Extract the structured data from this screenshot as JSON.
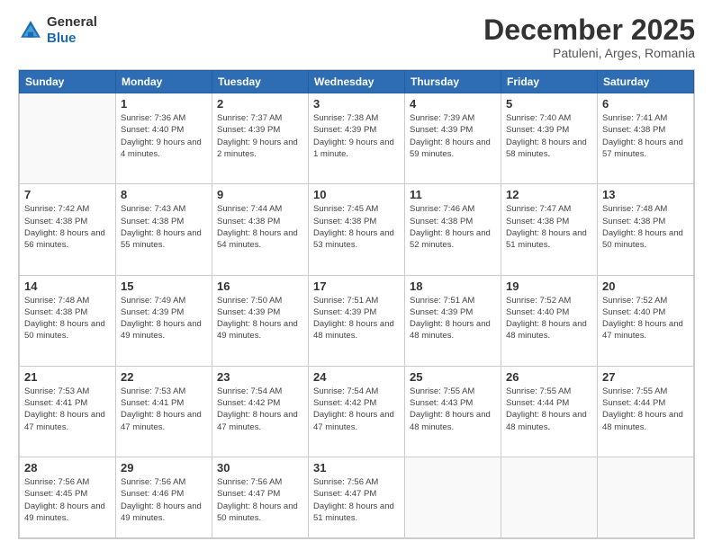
{
  "logo": {
    "general": "General",
    "blue": "Blue"
  },
  "header": {
    "month": "December 2025",
    "location": "Patuleni, Arges, Romania"
  },
  "weekdays": [
    "Sunday",
    "Monday",
    "Tuesday",
    "Wednesday",
    "Thursday",
    "Friday",
    "Saturday"
  ],
  "weeks": [
    [
      {
        "day": "",
        "sunrise": "",
        "sunset": "",
        "daylight": ""
      },
      {
        "day": "1",
        "sunrise": "Sunrise: 7:36 AM",
        "sunset": "Sunset: 4:40 PM",
        "daylight": "Daylight: 9 hours and 4 minutes."
      },
      {
        "day": "2",
        "sunrise": "Sunrise: 7:37 AM",
        "sunset": "Sunset: 4:39 PM",
        "daylight": "Daylight: 9 hours and 2 minutes."
      },
      {
        "day": "3",
        "sunrise": "Sunrise: 7:38 AM",
        "sunset": "Sunset: 4:39 PM",
        "daylight": "Daylight: 9 hours and 1 minute."
      },
      {
        "day": "4",
        "sunrise": "Sunrise: 7:39 AM",
        "sunset": "Sunset: 4:39 PM",
        "daylight": "Daylight: 8 hours and 59 minutes."
      },
      {
        "day": "5",
        "sunrise": "Sunrise: 7:40 AM",
        "sunset": "Sunset: 4:39 PM",
        "daylight": "Daylight: 8 hours and 58 minutes."
      },
      {
        "day": "6",
        "sunrise": "Sunrise: 7:41 AM",
        "sunset": "Sunset: 4:38 PM",
        "daylight": "Daylight: 8 hours and 57 minutes."
      }
    ],
    [
      {
        "day": "7",
        "sunrise": "Sunrise: 7:42 AM",
        "sunset": "Sunset: 4:38 PM",
        "daylight": "Daylight: 8 hours and 56 minutes."
      },
      {
        "day": "8",
        "sunrise": "Sunrise: 7:43 AM",
        "sunset": "Sunset: 4:38 PM",
        "daylight": "Daylight: 8 hours and 55 minutes."
      },
      {
        "day": "9",
        "sunrise": "Sunrise: 7:44 AM",
        "sunset": "Sunset: 4:38 PM",
        "daylight": "Daylight: 8 hours and 54 minutes."
      },
      {
        "day": "10",
        "sunrise": "Sunrise: 7:45 AM",
        "sunset": "Sunset: 4:38 PM",
        "daylight": "Daylight: 8 hours and 53 minutes."
      },
      {
        "day": "11",
        "sunrise": "Sunrise: 7:46 AM",
        "sunset": "Sunset: 4:38 PM",
        "daylight": "Daylight: 8 hours and 52 minutes."
      },
      {
        "day": "12",
        "sunrise": "Sunrise: 7:47 AM",
        "sunset": "Sunset: 4:38 PM",
        "daylight": "Daylight: 8 hours and 51 minutes."
      },
      {
        "day": "13",
        "sunrise": "Sunrise: 7:48 AM",
        "sunset": "Sunset: 4:38 PM",
        "daylight": "Daylight: 8 hours and 50 minutes."
      }
    ],
    [
      {
        "day": "14",
        "sunrise": "Sunrise: 7:48 AM",
        "sunset": "Sunset: 4:38 PM",
        "daylight": "Daylight: 8 hours and 50 minutes."
      },
      {
        "day": "15",
        "sunrise": "Sunrise: 7:49 AM",
        "sunset": "Sunset: 4:39 PM",
        "daylight": "Daylight: 8 hours and 49 minutes."
      },
      {
        "day": "16",
        "sunrise": "Sunrise: 7:50 AM",
        "sunset": "Sunset: 4:39 PM",
        "daylight": "Daylight: 8 hours and 49 minutes."
      },
      {
        "day": "17",
        "sunrise": "Sunrise: 7:51 AM",
        "sunset": "Sunset: 4:39 PM",
        "daylight": "Daylight: 8 hours and 48 minutes."
      },
      {
        "day": "18",
        "sunrise": "Sunrise: 7:51 AM",
        "sunset": "Sunset: 4:39 PM",
        "daylight": "Daylight: 8 hours and 48 minutes."
      },
      {
        "day": "19",
        "sunrise": "Sunrise: 7:52 AM",
        "sunset": "Sunset: 4:40 PM",
        "daylight": "Daylight: 8 hours and 48 minutes."
      },
      {
        "day": "20",
        "sunrise": "Sunrise: 7:52 AM",
        "sunset": "Sunset: 4:40 PM",
        "daylight": "Daylight: 8 hours and 47 minutes."
      }
    ],
    [
      {
        "day": "21",
        "sunrise": "Sunrise: 7:53 AM",
        "sunset": "Sunset: 4:41 PM",
        "daylight": "Daylight: 8 hours and 47 minutes."
      },
      {
        "day": "22",
        "sunrise": "Sunrise: 7:53 AM",
        "sunset": "Sunset: 4:41 PM",
        "daylight": "Daylight: 8 hours and 47 minutes."
      },
      {
        "day": "23",
        "sunrise": "Sunrise: 7:54 AM",
        "sunset": "Sunset: 4:42 PM",
        "daylight": "Daylight: 8 hours and 47 minutes."
      },
      {
        "day": "24",
        "sunrise": "Sunrise: 7:54 AM",
        "sunset": "Sunset: 4:42 PM",
        "daylight": "Daylight: 8 hours and 47 minutes."
      },
      {
        "day": "25",
        "sunrise": "Sunrise: 7:55 AM",
        "sunset": "Sunset: 4:43 PM",
        "daylight": "Daylight: 8 hours and 48 minutes."
      },
      {
        "day": "26",
        "sunrise": "Sunrise: 7:55 AM",
        "sunset": "Sunset: 4:44 PM",
        "daylight": "Daylight: 8 hours and 48 minutes."
      },
      {
        "day": "27",
        "sunrise": "Sunrise: 7:55 AM",
        "sunset": "Sunset: 4:44 PM",
        "daylight": "Daylight: 8 hours and 48 minutes."
      }
    ],
    [
      {
        "day": "28",
        "sunrise": "Sunrise: 7:56 AM",
        "sunset": "Sunset: 4:45 PM",
        "daylight": "Daylight: 8 hours and 49 minutes."
      },
      {
        "day": "29",
        "sunrise": "Sunrise: 7:56 AM",
        "sunset": "Sunset: 4:46 PM",
        "daylight": "Daylight: 8 hours and 49 minutes."
      },
      {
        "day": "30",
        "sunrise": "Sunrise: 7:56 AM",
        "sunset": "Sunset: 4:47 PM",
        "daylight": "Daylight: 8 hours and 50 minutes."
      },
      {
        "day": "31",
        "sunrise": "Sunrise: 7:56 AM",
        "sunset": "Sunset: 4:47 PM",
        "daylight": "Daylight: 8 hours and 51 minutes."
      },
      {
        "day": "",
        "sunrise": "",
        "sunset": "",
        "daylight": ""
      },
      {
        "day": "",
        "sunrise": "",
        "sunset": "",
        "daylight": ""
      },
      {
        "day": "",
        "sunrise": "",
        "sunset": "",
        "daylight": ""
      }
    ]
  ]
}
